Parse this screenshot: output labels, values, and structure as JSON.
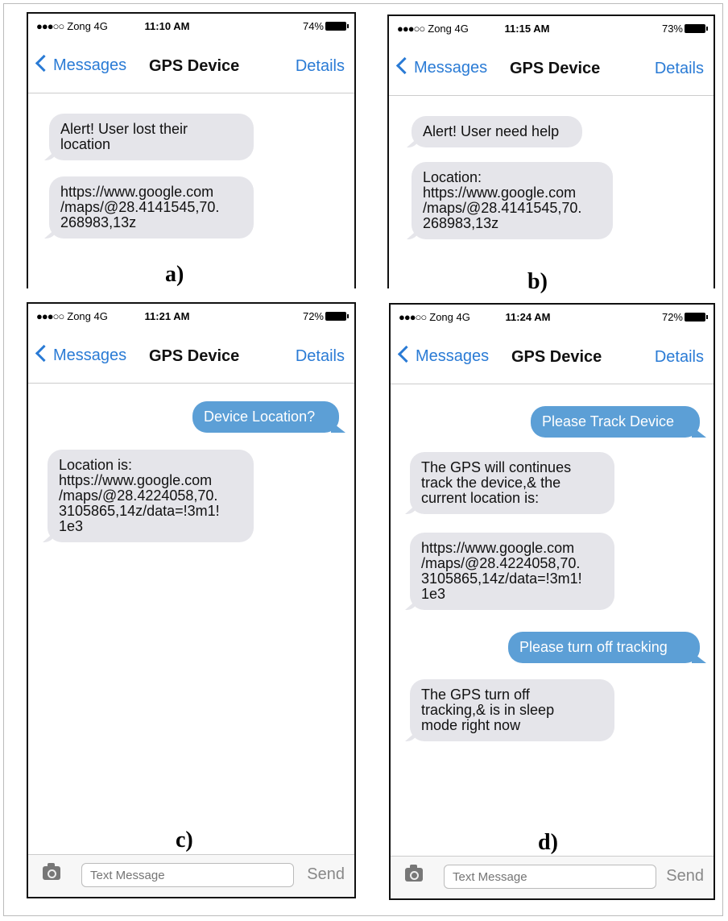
{
  "common": {
    "carrier": "Zong  4G",
    "signal_dots": "●●●○○",
    "back_label": "Messages",
    "title": "GPS Device",
    "details_label": "Details",
    "input_placeholder": "Text Message",
    "send_label": "Send"
  },
  "panels": {
    "a": {
      "label": "a)",
      "time": "11:10 AM",
      "battery": "74%",
      "messages": [
        {
          "dir": "in",
          "text": "Alert! User lost their\nlocation"
        },
        {
          "dir": "in",
          "text": "https://www.google.com\n/maps/@28.4141545,70.\n268983,13z"
        }
      ]
    },
    "b": {
      "label": "b)",
      "time": "11:15 AM",
      "battery": "73%",
      "messages": [
        {
          "dir": "in",
          "text": "Alert! User need help"
        },
        {
          "dir": "in",
          "text": "Location:\nhttps://www.google.com\n/maps/@28.4141545,70.\n268983,13z"
        }
      ]
    },
    "c": {
      "label": "c)",
      "time": "11:21 AM",
      "battery": "72%",
      "messages": [
        {
          "dir": "out",
          "text": "Device Location?"
        },
        {
          "dir": "in",
          "text": "Location is:\nhttps://www.google.com\n/maps/@28.4224058,70.\n3105865,14z/data=!3m1!\n1e3"
        }
      ]
    },
    "d": {
      "label": "d)",
      "time": "11:24 AM",
      "battery": "72%",
      "messages": [
        {
          "dir": "out",
          "text": "Please Track Device"
        },
        {
          "dir": "in",
          "text": "The GPS will continues\ntrack the device,& the\ncurrent location is:"
        },
        {
          "dir": "in",
          "text": "https://www.google.com\n/maps/@28.4224058,70.\n3105865,14z/data=!3m1!\n1e3"
        },
        {
          "dir": "out",
          "text": "Please turn off tracking"
        },
        {
          "dir": "in",
          "text": "The GPS turn off\ntracking,& is in sleep\nmode right now"
        }
      ]
    }
  }
}
